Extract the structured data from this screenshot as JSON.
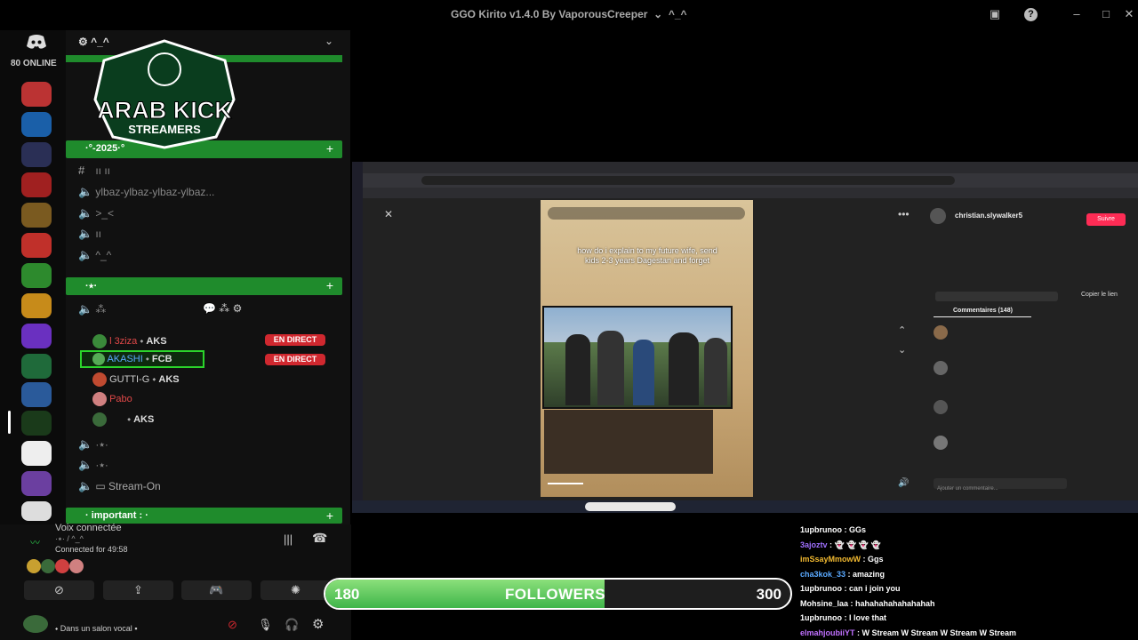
{
  "window": {
    "title": "GGO Kirito v1.4.0 By VaporousCreeper",
    "title_suffix": "^_^"
  },
  "server_rail": {
    "online_label": "80 ONLINE"
  },
  "channels": {
    "server_name": "^_^",
    "categories": [
      {
        "label": "·°-2025·°"
      },
      {
        "label": "·٭·"
      },
      {
        "label": "· important : ·"
      }
    ],
    "text_channels": [
      {
        "label": "ıı ıı"
      },
      {
        "label": "ylbaz-ylbaz-ylbaz-ylbaz..."
      },
      {
        "label": ">_<"
      },
      {
        "label": "ıı"
      },
      {
        "label": "^_^"
      },
      {
        "label": "·٭·"
      },
      {
        "label": "·٭·"
      },
      {
        "label": "Stream-On"
      }
    ],
    "voice_users": [
      {
        "name": "l 3ziza",
        "tag": "AKS",
        "name_color": "#e04848",
        "live": "EN DIRECT"
      },
      {
        "name": "AKASHI",
        "tag": "FCB",
        "name_color": "#5aa9ff",
        "live": "EN DIRECT"
      },
      {
        "name": "GUTTI-G",
        "tag": "AKS",
        "name_color": "#cccccc"
      },
      {
        "name": "Pabo",
        "tag": "",
        "name_color": "#e04848"
      },
      {
        "name": "",
        "tag": "AKS",
        "name_color": "#cccccc"
      }
    ]
  },
  "logo": {
    "line1": "ARAB KICK",
    "line2": "STREAMERS"
  },
  "voice_panel": {
    "status": "Voix connectée",
    "channel": "·٭· / ^_^",
    "duration": "Connected for 49:58",
    "footer_text": "Dans un salon vocal"
  },
  "followers": {
    "current": "180",
    "label": "FOLLOWERS",
    "goal": "300",
    "progress_fraction": 0.6
  },
  "stream": {
    "video_caption": "how do i explain to my future wife, send kids 2-3 years Dagestan and forget",
    "profile_name": "christian.slywalker5",
    "follow_button": "Suivre",
    "comments_tab": "Commentaires (148)",
    "copy_link": "Copier le lien",
    "comment_input": "Ajouter un commentaire..."
  },
  "chat": {
    "messages": [
      {
        "user": "1upbrunoo",
        "text": "GGs",
        "color": "#ffffff"
      },
      {
        "user": "3ajoztv",
        "text": "👻 👻 👻 👻",
        "color": "#a070ff"
      },
      {
        "user": "imSsayMmowW",
        "text": "Ggs",
        "color": "#f0b830"
      },
      {
        "user": "cha3kok_33",
        "text": "amazing",
        "color": "#5aa9ff"
      },
      {
        "user": "1upbrunoo",
        "text": "can i join you",
        "color": "#ffffff"
      },
      {
        "user": "Mohsine_laa",
        "text": "hahahahahahahahah",
        "color": "#ffffff"
      },
      {
        "user": "1upbrunoo",
        "text": "I love that",
        "color": "#ffffff"
      },
      {
        "user": "elmahjoubiiYT",
        "text": "W Stream W Stream W Stream W Stream",
        "color": "#c070ff"
      }
    ]
  },
  "colors": {
    "category_green": "#1f8b2c",
    "live_red": "#d0282f",
    "follow_fill": "#5cc95a"
  }
}
